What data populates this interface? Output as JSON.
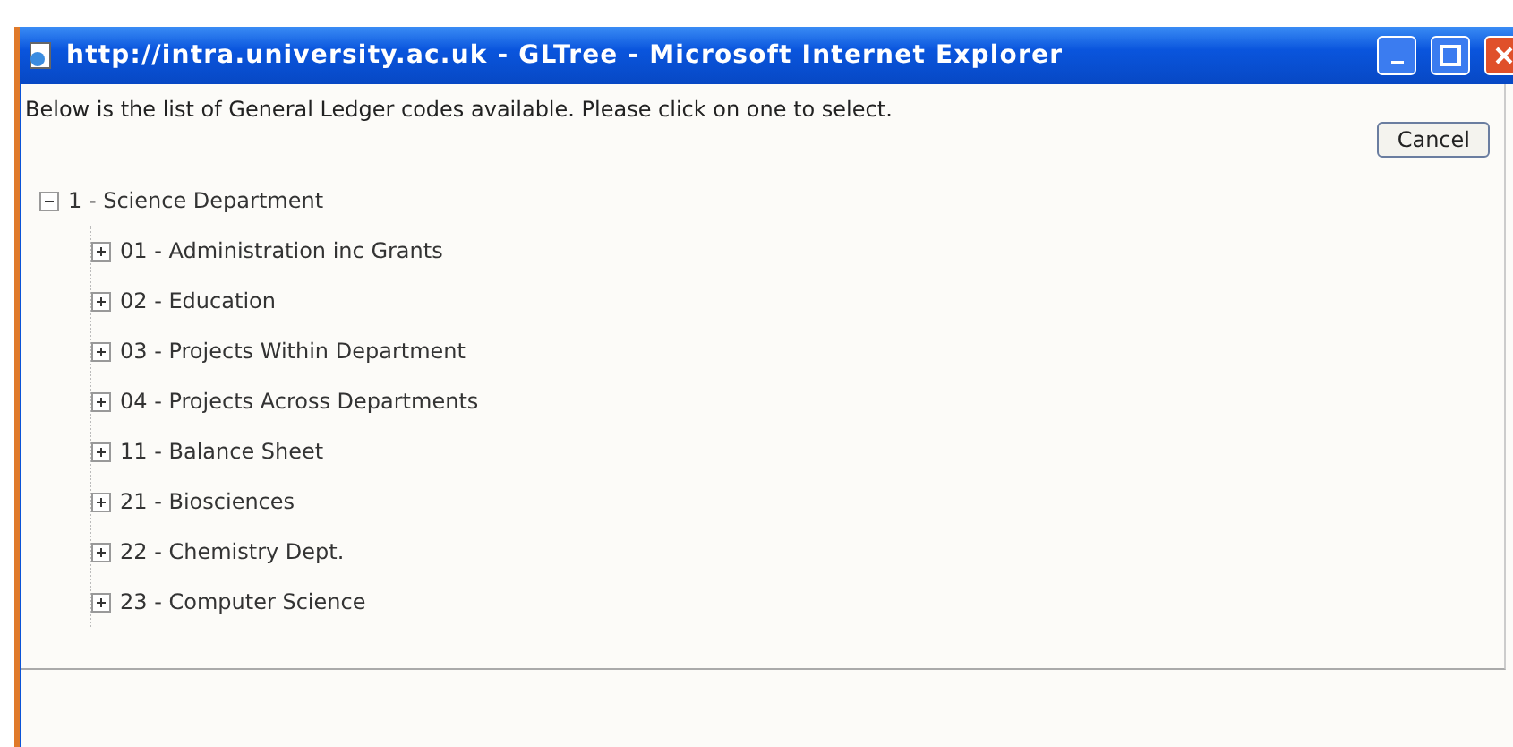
{
  "window": {
    "title": "http://intra.university.ac.uk - GLTree - Microsoft Internet Explorer"
  },
  "intro": "Below is the list of General Ledger codes available. Please click on one to select.",
  "cancel_button": "Cancel",
  "tree": [
    {
      "label": "1 - Science Department",
      "expanded": true,
      "children": [
        {
          "label": "01 - Administration inc Grants",
          "expanded": false
        },
        {
          "label": "02 - Education",
          "expanded": false
        },
        {
          "label": "03 - Projects Within Department",
          "expanded": false
        },
        {
          "label": "04 - Projects Across Departments",
          "expanded": false
        },
        {
          "label": "11 - Balance Sheet",
          "expanded": false
        },
        {
          "label": "21 - Biosciences",
          "expanded": false
        },
        {
          "label": "22 - Chemistry Dept.",
          "expanded": false
        },
        {
          "label": "23 - Computer Science",
          "expanded": false
        }
      ]
    }
  ]
}
